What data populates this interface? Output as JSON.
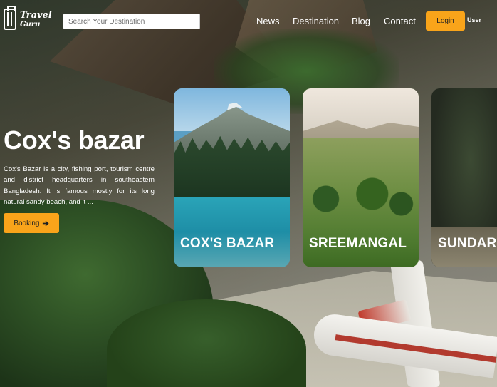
{
  "brand": {
    "line1": "Travel",
    "line2": "Guru"
  },
  "search": {
    "placeholder": "Search Your Destination"
  },
  "nav": {
    "items": [
      "News",
      "Destination",
      "Blog",
      "Contact"
    ],
    "login_label": "Login",
    "user_label": "User"
  },
  "hero": {
    "title": "Cox's bazar",
    "description": "Cox's Bazar is a city, fishing port, tourism centre and district headquarters in southeastern Bangladesh. It is famous mostly for its long natural sandy beach, and it ...",
    "booking_label": "Booking",
    "booking_icon": "arrow-right-icon"
  },
  "cards": [
    {
      "label": "COX'S BAZAR"
    },
    {
      "label": "SREEMANGAL"
    },
    {
      "label": "SUNDARBANS"
    }
  ],
  "colors": {
    "accent": "#f9a41a"
  }
}
